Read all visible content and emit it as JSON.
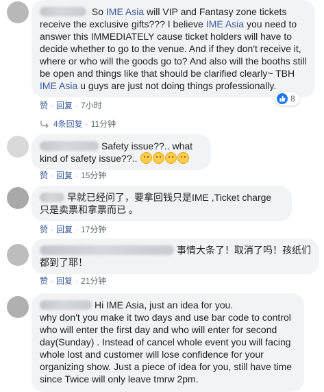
{
  "comments": [
    {
      "text_link1": "IME Asia",
      "text_p1": " So ",
      "text_p2": " will VIP and Fantasy zone tickets receive the exclusive gifts??? I believe ",
      "text_p3": " you need to answer this IMMEDIATELY cause ticket holders will have to decide whether to go to the venue. And if they don't receive it, where or who will the goods go to? And also will the booths still be open and things like that should be clarified clearly~ TBH ",
      "text_p4": " u guys are just not doing things professionally.",
      "like": "赞",
      "reply": "回复",
      "time": "7小时",
      "reaction_count": "8",
      "replies_label": "4条回复",
      "replies_time": "11分钟"
    },
    {
      "text": "Safety issue??.. what kind of safety issue??..",
      "like": "赞",
      "reply": "回复",
      "time": "15分钟"
    },
    {
      "text": "早就已经问了，要拿回钱只是IME ,Ticket charge 只是卖票和拿票而已 。",
      "like": "赞",
      "reply": "回复",
      "time": "17分钟"
    },
    {
      "text": "事情大条了！取消了吗！孩纸们都到了耶！",
      "like": "赞",
      "reply": "回复",
      "time": "21分钟"
    },
    {
      "text_first": "Hi IME Asia, just an idea for you.",
      "text": "why don't you make it two days and use bar code to control who will enter the first day and who will enter for second day(Sunday) . Instead of cancel whole event you will facing whole lost and customer will lose confidence for your organizing show. Just a piece of idea for you, still have time since Twice will only leave tmrw 2pm."
    }
  ],
  "colors": {
    "bubble_bg": "#f2f3f5",
    "link": "#385898",
    "meta": "#606770",
    "like_blue": "#1877f2"
  }
}
